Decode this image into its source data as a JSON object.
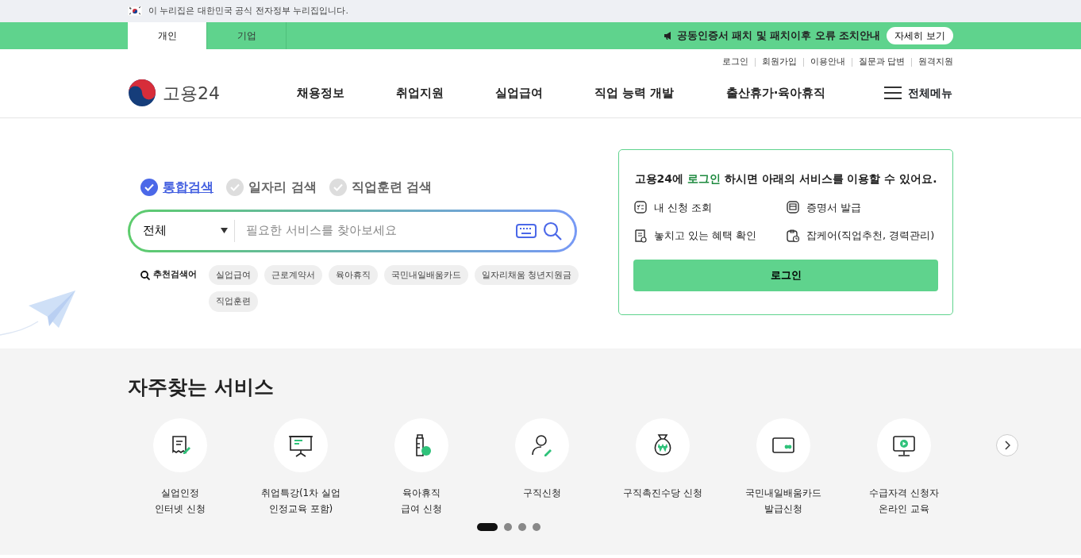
{
  "gov_banner": {
    "text": "이 누리집은 대한민국 공식 전자정부 누리집입니다."
  },
  "audience_tabs": [
    {
      "label": "개인",
      "selected": true
    },
    {
      "label": "기업",
      "selected": false
    }
  ],
  "notice": {
    "text": "공동인증서 패치 및 패치이후 오류 조치안내",
    "button": "자세히 보기"
  },
  "util_links": [
    "로그인",
    "회원가입",
    "이용안내",
    "질문과 답변",
    "원격지원"
  ],
  "logo": {
    "text": "고용24"
  },
  "nav": [
    "채용정보",
    "취업지원",
    "실업급여",
    "직업 능력 개발",
    "출산휴가·육아휴직"
  ],
  "all_menu": "전체메뉴",
  "search_tabs": [
    {
      "label": "통합검색",
      "selected": true
    },
    {
      "label": "일자리 검색",
      "selected": false
    },
    {
      "label": "직업훈련 검색",
      "selected": false
    }
  ],
  "search": {
    "category": "전체",
    "placeholder": "필요한 서비스를 찾아보세요"
  },
  "recommended": {
    "label": "추천검색어",
    "keywords": [
      "실업급여",
      "근로계약서",
      "육아휴직",
      "국민내일배움카드",
      "일자리채움 청년지원금",
      "직업훈련"
    ]
  },
  "login_card": {
    "message": "고용24에 **로그인** 하시면 아래의 서비스를 이용할 수 있어요.",
    "services": [
      "내 신청 조회",
      "증명서 발급",
      "놓치고 있는 혜택 확인",
      "잡케어(직업추천, 경력관리)"
    ],
    "button": "로그인"
  },
  "frequent_services": {
    "title": "자주찾는 서비스",
    "items": [
      {
        "label": "실업인정\n인터넷 신청"
      },
      {
        "label": "취업특강(1차 실업\n인정교육 포함)"
      },
      {
        "label": "육아휴직\n급여 신청"
      },
      {
        "label": "구직신청"
      },
      {
        "label": "구직촉진수당 신청"
      },
      {
        "label": "국민내일배움카드\n발급신청"
      },
      {
        "label": "수급자격 신청자\n온라인 교육"
      }
    ],
    "pages": [
      {
        "selected": true
      },
      {
        "selected": false
      },
      {
        "selected": false
      },
      {
        "selected": false
      }
    ]
  }
}
